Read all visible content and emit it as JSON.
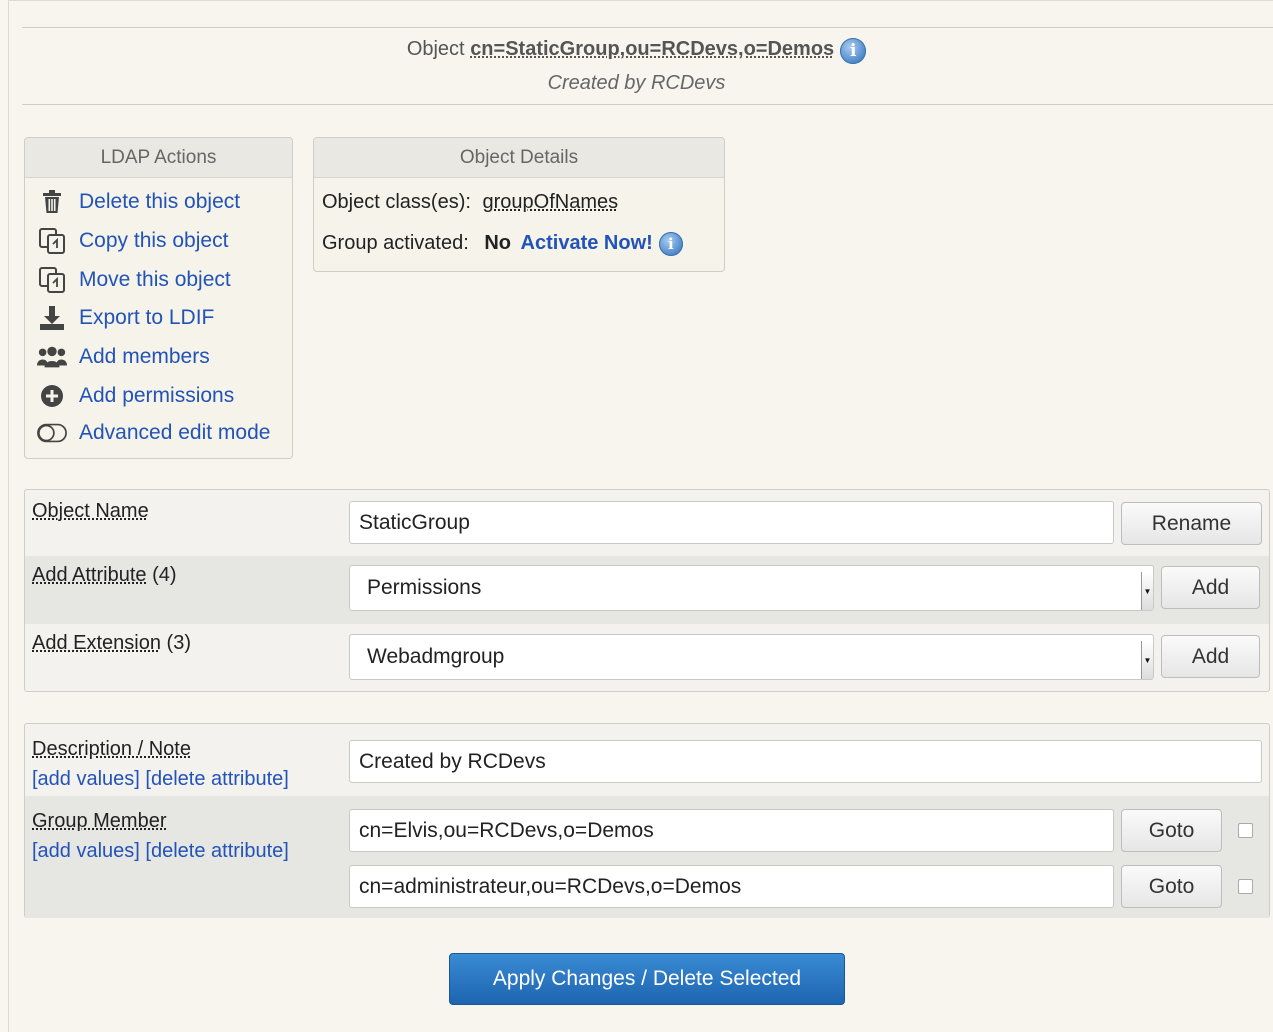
{
  "header": {
    "object_prefix": "Object",
    "dn": "cn=StaticGroup,ou=RCDevs,o=Demos",
    "created_by": "Created by RCDevs",
    "info_icon": "i"
  },
  "ldap_actions": {
    "title": "LDAP Actions",
    "items": [
      {
        "label": "Delete this object",
        "icon": "trash-icon"
      },
      {
        "label": "Copy this object",
        "icon": "copy-icon"
      },
      {
        "label": "Move this object",
        "icon": "move-icon"
      },
      {
        "label": "Export to LDIF",
        "icon": "download-icon"
      },
      {
        "label": "Add members",
        "icon": "users-icon"
      },
      {
        "label": "Add permissions",
        "icon": "plus-circle-icon"
      },
      {
        "label": "Advanced edit mode",
        "icon": "toggle-icon"
      }
    ]
  },
  "object_details": {
    "title": "Object Details",
    "class_label": "Object class(es):",
    "class_value": "groupOfNames",
    "activated_label": "Group activated:",
    "activated_value": "No",
    "activate_link": "Activate Now!"
  },
  "form": {
    "object_name": {
      "label": "Object Name",
      "value": "StaticGroup",
      "button": "Rename"
    },
    "add_attribute": {
      "label": "Add Attribute",
      "count": "(4)",
      "selected": "Permissions",
      "button": "Add"
    },
    "add_extension": {
      "label": "Add Extension",
      "count": "(3)",
      "selected": "Webadmgroup",
      "button": "Add"
    }
  },
  "attributes": {
    "description": {
      "label": "Description / Note",
      "add_values": "[add values]",
      "delete_attribute": "[delete attribute]",
      "value": "Created by RCDevs"
    },
    "group_member": {
      "label": "Group Member",
      "add_values": "[add values]",
      "delete_attribute": "[delete attribute]",
      "members": [
        {
          "value": "cn=Elvis,ou=RCDevs,o=Demos",
          "button": "Goto"
        },
        {
          "value": "cn=administrateur,ou=RCDevs,o=Demos",
          "button": "Goto"
        }
      ]
    }
  },
  "apply_button": "Apply Changes / Delete Selected",
  "colors": {
    "link": "#2253b6",
    "primary_button": "#1e65b0",
    "background": "#f7f5ed"
  }
}
